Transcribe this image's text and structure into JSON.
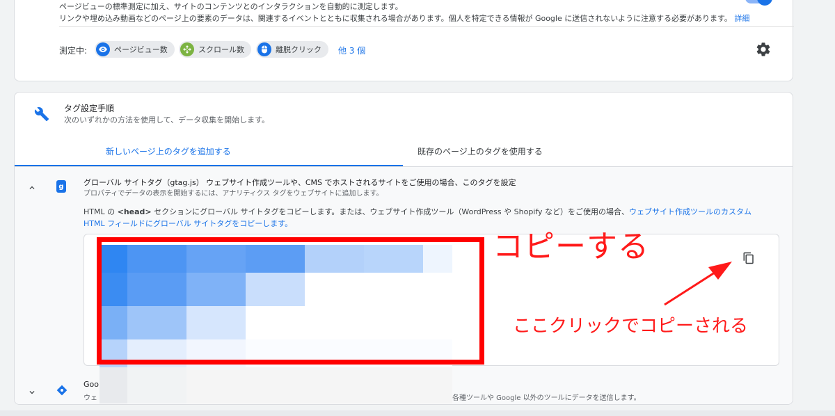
{
  "top_card": {
    "line1": "ページビューの標準測定に加え、サイトのコンテンツとのインタラクションを自動的に測定します。",
    "line2": "リンクや埋め込み動画などのページ上の要素のデータは、関連するイベントとともに収集される場合があります。個人を特定できる情報が Google に送信されないように注意する必要があります。",
    "details_link": "詳細",
    "measuring_label": "測定中:",
    "chips": [
      "ページビュー数",
      "スクロール数",
      "離脱クリック"
    ],
    "more_link": "他 3 個"
  },
  "setup": {
    "title": "タグ設定手順",
    "subtitle": "次のいずれかの方法を使用して、データ収集を開始します。",
    "tabs": [
      "新しいページ上のタグを追加する",
      "既存のページ上のタグを使用する"
    ]
  },
  "gtag": {
    "title": "グローバル サイトタグ（gtag.js） ウェブサイト作成ツールや、CMS でホストされるサイトをご使用の場合、このタグを設定",
    "subtitle": "プロパティでデータの表示を開始するには、アナリティクス タグをウェブサイトに追加します。",
    "instruction_part1": "HTML の ",
    "instruction_head": "<head>",
    "instruction_part2": " セクションにグローバル サイトタグをコピーします。または、ウェブサイト作成ツール（WordPress や Shopify など）をご使用の場合、",
    "instruction_link1": "ウェブサイト作成ツールのカスタム",
    "instruction_link2": "HTML フィールドにグローバル サイトタグをコピーします。"
  },
  "gtm": {
    "title": "Goo",
    "subtitle": "ウェ",
    "subtitle_tail": "各種ツールや Google 以外のツールにデータを送信します。"
  },
  "annotations": {
    "copy": "コピーする",
    "click_hint": "ここクリックでコピーされる"
  },
  "colors": {
    "accent": "#1a73e8",
    "annotation": "#ff0000"
  }
}
